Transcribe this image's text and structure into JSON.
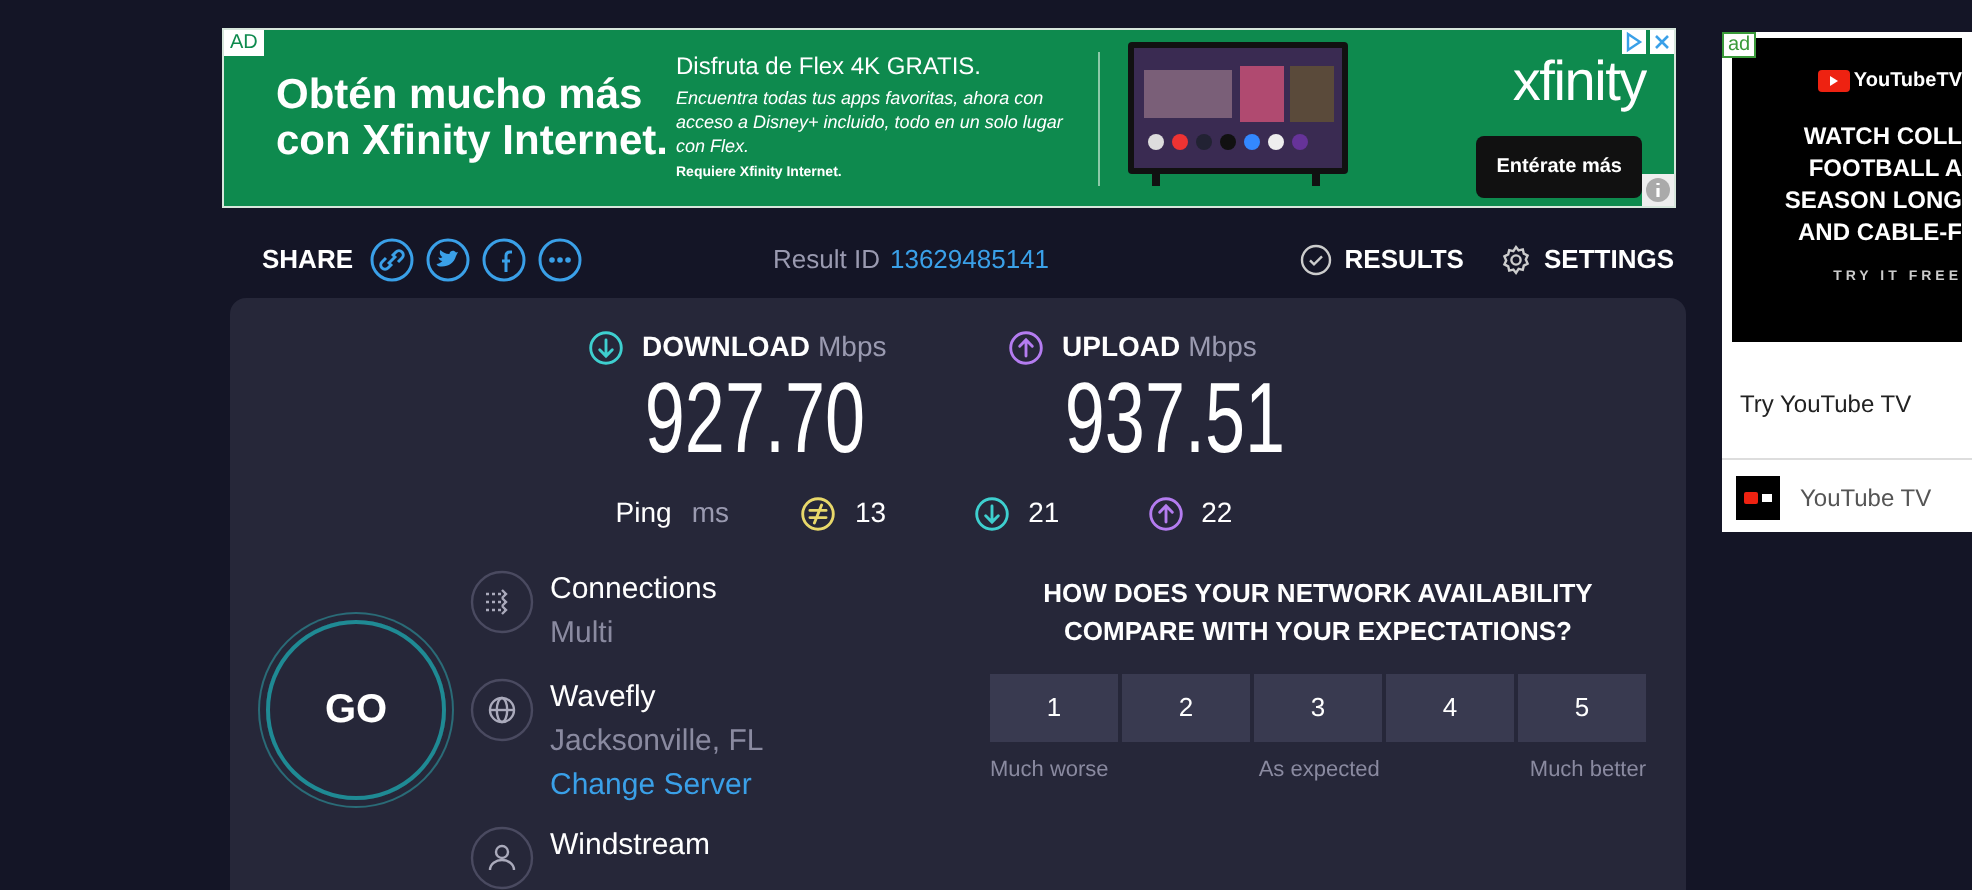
{
  "ad_banner": {
    "badge": "AD",
    "headline": "Obtén mucho más con Xfinity Internet.",
    "title": "Disfruta de Flex 4K GRATIS.",
    "body": "Encuentra todas tus apps favoritas, ahora con acceso a Disney+ incluido, todo en un solo lugar con Flex.",
    "note": "Requiere Xfinity Internet.",
    "brand": "xfinity",
    "button": "Entérate más"
  },
  "side_ad": {
    "badge": "ad",
    "brand": "YouTubeTV",
    "lines": [
      "WATCH COLL",
      "FOOTBALL A",
      "SEASON LONG",
      "AND CABLE-F"
    ],
    "cta": "TRY IT FREE",
    "headline": "Try YouTube TV",
    "advertiser": "YouTube TV"
  },
  "share": {
    "label": "SHARE",
    "buttons": [
      {
        "kind": "link"
      },
      {
        "kind": "twitter"
      },
      {
        "kind": "facebook"
      },
      {
        "kind": "more"
      }
    ]
  },
  "result": {
    "label": "Result ID",
    "id": "13629485141"
  },
  "nav": [
    {
      "kind": "results",
      "label": "RESULTS"
    },
    {
      "kind": "settings",
      "label": "SETTINGS"
    }
  ],
  "speeds": [
    {
      "kind": "download",
      "label": "DOWNLOAD",
      "unit": "Mbps",
      "value": "927.70"
    },
    {
      "kind": "upload",
      "label": "UPLOAD",
      "unit": "Mbps",
      "value": "937.51"
    }
  ],
  "ping": {
    "label": "Ping",
    "unit": "ms",
    "items": [
      {
        "kind": "jitter",
        "value": "13"
      },
      {
        "kind": "download",
        "value": "21"
      },
      {
        "kind": "upload",
        "value": "22"
      }
    ]
  },
  "go": "GO",
  "server": [
    {
      "kind": "connections",
      "title": "Connections",
      "sub": "Multi"
    },
    {
      "kind": "server",
      "title": "Wavefly",
      "sub": "Jacksonville, FL",
      "link": "Change Server"
    },
    {
      "kind": "isp",
      "title": "Windstream"
    }
  ],
  "survey": {
    "question": "HOW DOES YOUR NETWORK AVAILABILITY COMPARE WITH YOUR EXPECTATIONS?",
    "options": [
      "1",
      "2",
      "3",
      "4",
      "5"
    ],
    "scale": [
      "Much worse",
      "As expected",
      "Much better"
    ]
  }
}
